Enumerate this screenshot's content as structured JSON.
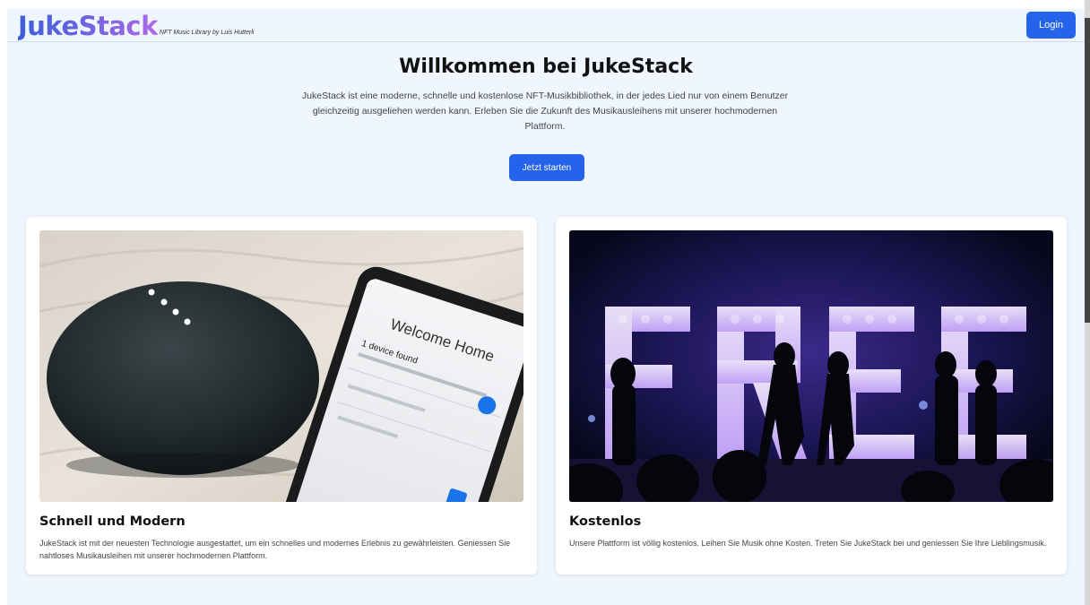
{
  "header": {
    "logo_text": "JukeStack",
    "logo_subtitle": "NFT Music Library by Luis Hutterli",
    "login_label": "Login"
  },
  "hero": {
    "title": "Willkommen bei JukeStack",
    "description": "JukeStack ist eine moderne, schnelle und kostenlose NFT-Musikbibliothek, in der jedes Lied nur von einem Benutzer gleichzeitig ausgeliehen werden kann. Erleben Sie die Zukunft des Musikausleihens mit unserer hochmodernen Plattform.",
    "cta_label": "Jetzt starten"
  },
  "cards": [
    {
      "title": "Schnell und Modern",
      "text": "JukeStack ist mit der neuesten Technologie ausgestattet, um ein schnelles und modernes Erlebnis zu gewährleisten. Geniessen Sie nahtloses Musikausleihen mit unserer hochmodernen Plattform.",
      "image": {
        "phone_heading": "Welcome Home",
        "phone_status": "1 device found"
      }
    },
    {
      "title": "Kostenlos",
      "text": "Unsere Plattform ist völlig kostenlos. Leihen Sie Musik ohne Kosten. Treten Sie JukeStack bei und geniessen Sie Ihre Lieblingsmusik.",
      "image": {
        "sign_letters": [
          "F",
          "R",
          "E",
          "E"
        ]
      }
    }
  ],
  "colors": {
    "accent": "#2563eb",
    "page_background": "#eff6ff",
    "card_background": "#ffffff"
  }
}
